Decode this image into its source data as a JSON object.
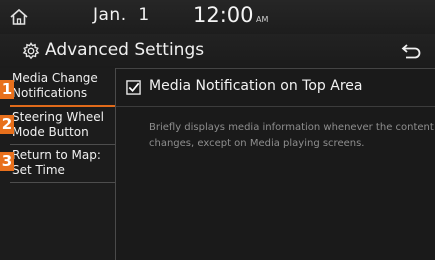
{
  "status": {
    "date": "Jan.  1",
    "time": "12:00",
    "ampm": "AM"
  },
  "header": {
    "title": "Advanced Settings"
  },
  "sidebar": {
    "items": [
      {
        "marker": "1",
        "label_line1": "Media Change",
        "label_line2": "Notifications",
        "active": true
      },
      {
        "marker": "2",
        "label_line1": "Steering Wheel",
        "label_line2": "Mode Button",
        "active": false
      },
      {
        "marker": "3",
        "label_line1": "Return to Map:",
        "label_line2": "Set Time",
        "active": false
      }
    ]
  },
  "main": {
    "option": {
      "label": "Media Notification on Top Area",
      "checked": true
    },
    "description": "Briefly displays media information whenever the content changes, except on Media playing screens."
  },
  "colors": {
    "accent": "#e8701c",
    "background": "#1a1a1a",
    "text": "#f0f0f0",
    "muted_text": "#8e8e8e"
  },
  "icons": {
    "home": "home-icon",
    "settings": "gear-icon",
    "back": "back-arrow-icon",
    "checkbox": "checkbox-checked-icon"
  }
}
